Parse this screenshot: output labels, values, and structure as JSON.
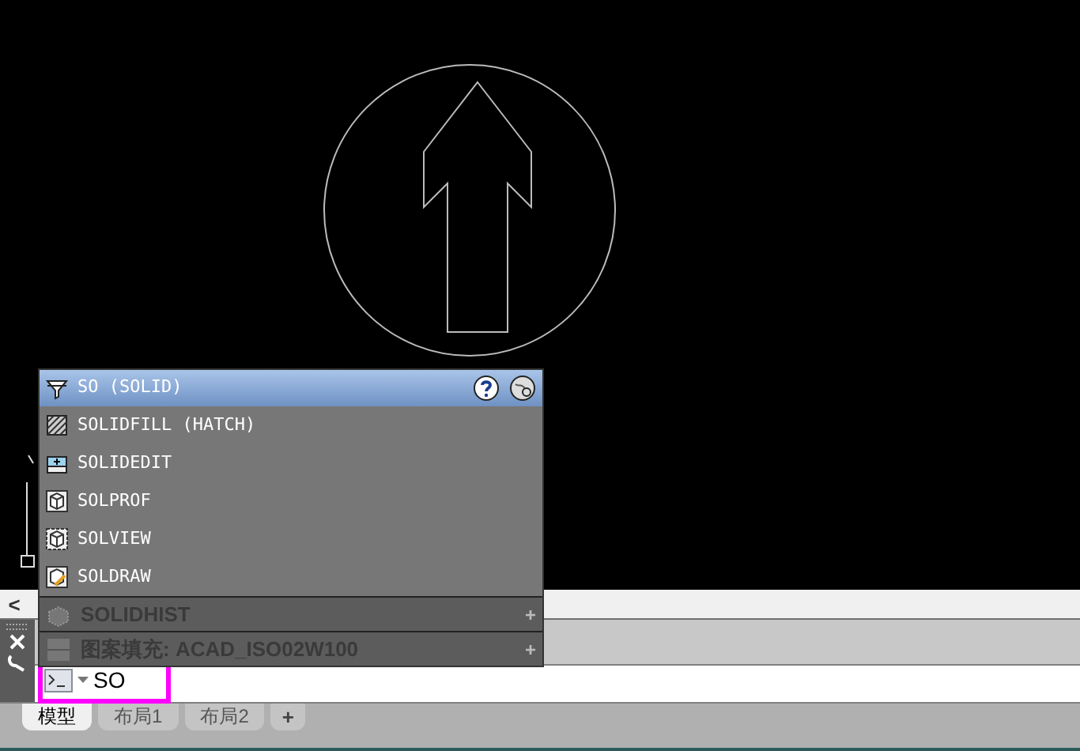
{
  "autocomplete": {
    "header": "SO (SOLID)",
    "items": [
      {
        "label": "SOLIDFILL (HATCH)",
        "kind": "hatch"
      },
      {
        "label": "SOLIDEDIT",
        "kind": "edit"
      },
      {
        "label": "SOLPROF",
        "kind": "cube"
      },
      {
        "label": "SOLVIEW",
        "kind": "view"
      },
      {
        "label": "SOLDRAW",
        "kind": "draw"
      }
    ],
    "sections": [
      {
        "label": "SOLIDHIST",
        "kind": "solid",
        "expand": "+"
      },
      {
        "label": "图案填充: ACAD_ISO02W100",
        "kind": "hatch",
        "expand": "+"
      }
    ]
  },
  "collapse_toggle": "<",
  "command_line": {
    "value": "SO"
  },
  "layout_tabs": [
    {
      "label": "模型",
      "selected": true
    },
    {
      "label": "布局1",
      "selected": false
    },
    {
      "label": "布局2",
      "selected": false
    }
  ],
  "add_tab": "+"
}
